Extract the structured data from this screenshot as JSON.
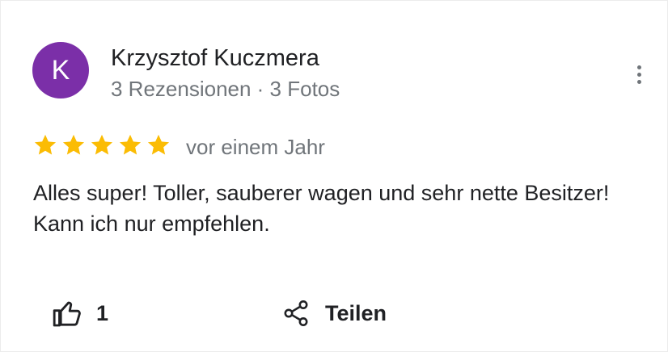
{
  "colors": {
    "avatar_bg": "#7b2fa8",
    "star": "#fbbc04",
    "text_primary": "#202124",
    "text_secondary": "#70757a"
  },
  "review": {
    "author": {
      "initial": "K",
      "name": "Krzysztof Kuczmera",
      "meta": "3 Rezensionen · 3 Fotos"
    },
    "rating": 5,
    "rating_max": 5,
    "date": "vor einem Jahr",
    "text": "Alles super! Toller, sauberer wagen und sehr nette Besitzer! Kann ich nur empfehlen.",
    "more_icon": "more-vert-icon"
  },
  "actions": {
    "like": {
      "icon": "thumb-up-icon",
      "count": "1"
    },
    "share": {
      "icon": "share-icon",
      "label": "Teilen"
    }
  }
}
